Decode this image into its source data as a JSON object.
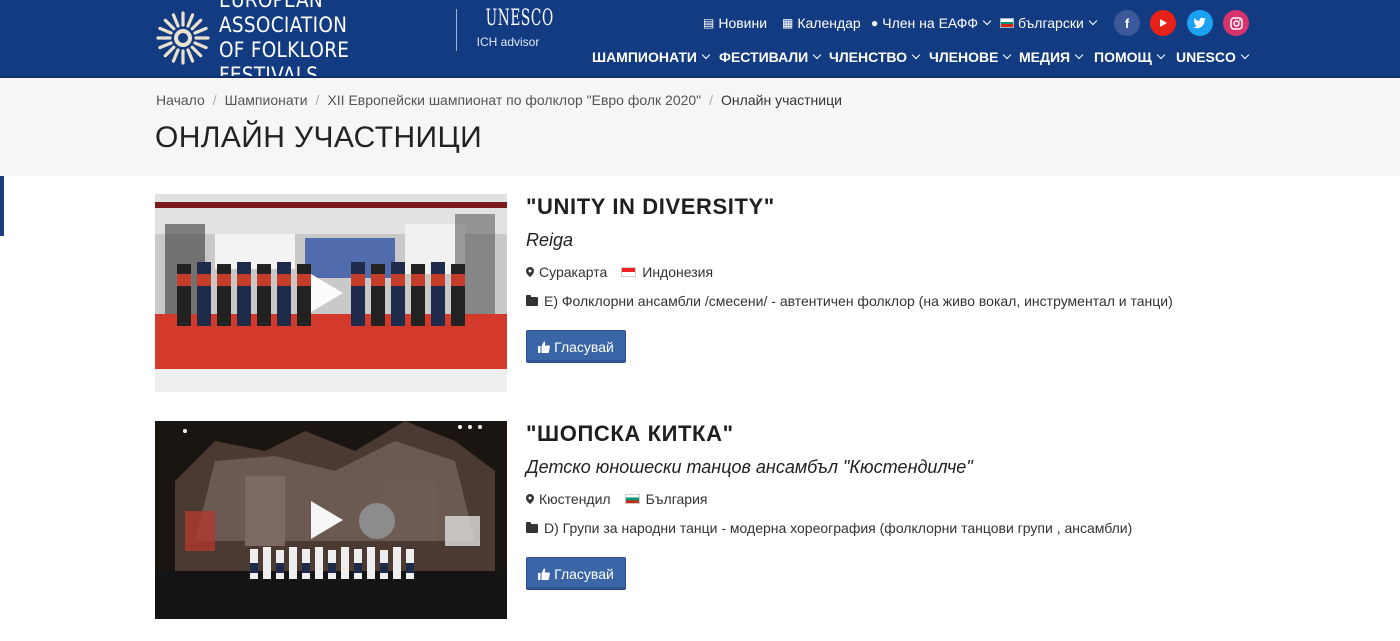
{
  "header": {
    "logo_line1": "EUROPEAN ASSOCIATION",
    "logo_line2": "OF FOLKLORE FESTIVALS",
    "unesco_word": "UNESCO",
    "unesco_sub": "ICH advisor",
    "top_links": {
      "news": "Новини",
      "calendar": "Календар",
      "member": "Член на ЕАФФ",
      "language": "български"
    },
    "social": [
      "facebook",
      "youtube",
      "twitter",
      "instagram"
    ],
    "nav": {
      "championships": "ШАМПИОНАТИ",
      "festivals": "ФЕСТИВАЛИ",
      "membership": "ЧЛЕНСТВО",
      "members": "ЧЛЕНОВЕ",
      "media": "МЕДИЯ",
      "help": "ПОМОЩ",
      "unesco": "UNESCO"
    },
    "colors": {
      "header_bg": "#123b82",
      "facebook": "#3b5998",
      "youtube": "#e62117",
      "twitter": "#1da1f2",
      "instagram": "#d6336c"
    }
  },
  "breadcrumb": {
    "home": "Начало",
    "championships": "Шампионати",
    "event": "XII Европейски шампионат по фолклор \"Евро фолк 2020\"",
    "current": "Онлайн участници"
  },
  "page_title": "ОНЛАЙН УЧАСТНИЦИ",
  "entries": [
    {
      "title": "\"UNITY IN DIVERSITY\"",
      "group": "Reiga",
      "city": "Суракарта",
      "country": "Индонезия",
      "category": "E) Фолклорни ансамбли /смесени/ - автентичен фолклор (на живо вокал, инструментал и танци)",
      "vote_label": "Гласувай"
    },
    {
      "title": "\"ШОПСКА КИТКА\"",
      "group": "Детско юношески танцов ансамбъл \"Кюстендилче\"",
      "city": "Кюстендил",
      "country": "България",
      "category": "D) Групи за народни танци - модерна хореография (фолклорни танцови групи , ансамбли)",
      "vote_label": "Гласувай"
    }
  ],
  "icons": {
    "news": "newspaper-icon",
    "calendar": "calendar-icon",
    "user": "user-icon",
    "location": "map-marker-icon",
    "category": "folder-icon",
    "vote": "thumbs-up-icon",
    "play": "play-icon"
  }
}
